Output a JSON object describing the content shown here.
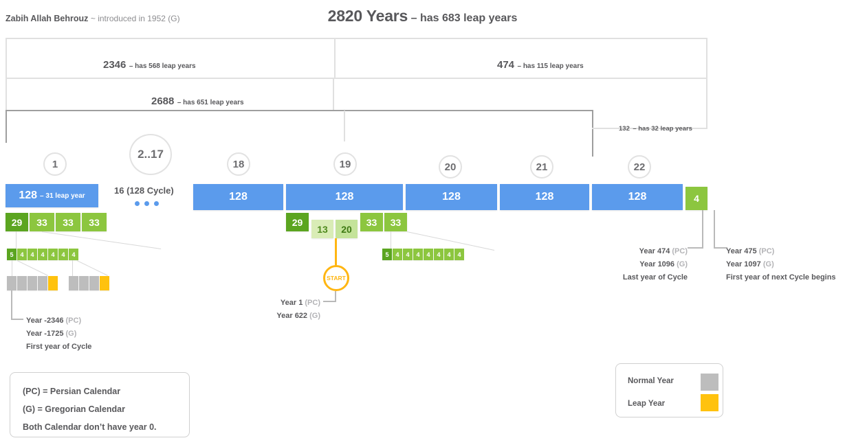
{
  "header": {
    "author": "Zabih Allah Behrouz",
    "author_note": "~ introduced in 1952 (G)",
    "title_main": "2820 Years",
    "title_sub": "– has 683 leap years"
  },
  "brackets": [
    {
      "id": "b2346",
      "number": "2346",
      "note": "– has 568 leap years"
    },
    {
      "id": "b474",
      "number": "474",
      "note": "– has 115 leap years"
    },
    {
      "id": "b2688",
      "number": "2688",
      "note": "– has 651 leap years"
    },
    {
      "id": "b132",
      "number": "132",
      "note": "– has 32 leap years"
    }
  ],
  "cycles": [
    {
      "circle": "1",
      "block": "128",
      "block_note": "– 31 leap year"
    },
    {
      "circle": "2..17",
      "block": "",
      "block_note": ""
    },
    {
      "circle": "18",
      "block": "128",
      "block_note": ""
    },
    {
      "circle": "19",
      "block": "128",
      "block_note": ""
    },
    {
      "circle": "20",
      "block": "128",
      "block_note": ""
    },
    {
      "circle": "21",
      "block": "128",
      "block_note": ""
    },
    {
      "circle": "22",
      "block": "128",
      "block_note": ""
    }
  ],
  "ellipsis_label": "16 (128 Cycle)",
  "remainder_block": "4",
  "subcycles_left": [
    "29",
    "33",
    "33",
    "33"
  ],
  "subcycles_mid": [
    "29",
    "13",
    "20",
    "33",
    "33"
  ],
  "strip_left": [
    "5",
    "4",
    "4",
    "4",
    "4",
    "4",
    "4"
  ],
  "strip_right": [
    "5",
    "4",
    "4",
    "4",
    "4",
    "4",
    "4",
    "4"
  ],
  "start_label": "START",
  "annotations": {
    "first_year": {
      "l1_a": "Year -2346 ",
      "l1_b": "(PC)",
      "l2_a": "Year -1725 ",
      "l2_b": "(G)",
      "l3": "First year of Cycle"
    },
    "start": {
      "l1_a": "Year 1 ",
      "l1_b": "(PC)",
      "l2_a": "Year 622 ",
      "l2_b": "(G)"
    },
    "last_year": {
      "l1_a": "Year 474 ",
      "l1_b": "(PC)",
      "l2_a": "Year 1096 ",
      "l2_b": "(G)",
      "l3": "Last year of Cycle"
    },
    "next_cycle": {
      "l1_a": "Year 475 ",
      "l1_b": "(PC)",
      "l2_a": "Year 1097 ",
      "l2_b": "(G)",
      "l3": "First year of next Cycle begins"
    }
  },
  "legend_notes": {
    "line1": "(PC) = Persian Calendar",
    "line2": "(G) = Gregorian Calendar",
    "line3": "Both Calendar don’t have year 0."
  },
  "legend_colors": {
    "normal_label": "Normal Year",
    "leap_label": "Leap Year",
    "normal_color": "#bdbdbd",
    "leap_color": "#ffc20e"
  },
  "palette": {
    "blue": "#5b9bec",
    "green_dark": "#5ba520",
    "green_mid": "#8cc63f",
    "green_pale": "#d9ecb6",
    "amber": "#ffc20e",
    "orange": "#ffb612",
    "grey": "#bdbdbd",
    "text": "#58585b"
  }
}
